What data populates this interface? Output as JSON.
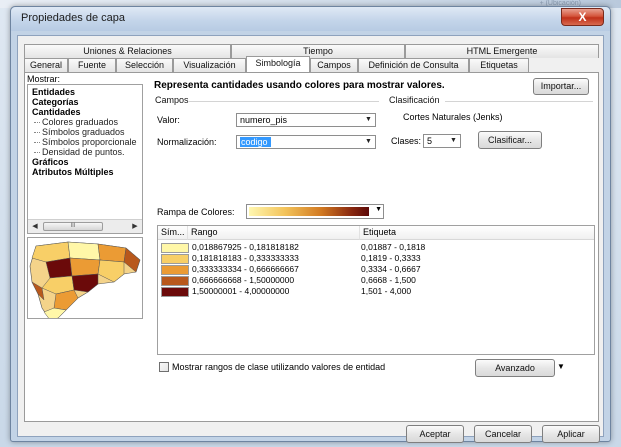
{
  "window": {
    "title": "Propiedades de capa",
    "close_label": "X"
  },
  "background": {
    "ghost_text": "+ (Ubicación)"
  },
  "tabs_row1": [
    {
      "label": "Uniones & Relaciones"
    },
    {
      "label": "Tiempo"
    },
    {
      "label": "HTML Emergente"
    }
  ],
  "tabs_row2": [
    {
      "label": "General"
    },
    {
      "label": "Fuente"
    },
    {
      "label": "Selección"
    },
    {
      "label": "Visualización"
    },
    {
      "label": "Simbología"
    },
    {
      "label": "Campos"
    },
    {
      "label": "Definición de Consulta"
    },
    {
      "label": "Etiquetas"
    }
  ],
  "active_tab": "Simbología",
  "sidebar": {
    "mostrar_label": "Mostrar:",
    "items": [
      {
        "label": "Entidades",
        "bold": true
      },
      {
        "label": "Categorías",
        "bold": true
      },
      {
        "label": "Cantidades",
        "bold": true
      },
      {
        "label": "Colores graduados",
        "bold": false
      },
      {
        "label": "Símbolos graduados",
        "bold": false
      },
      {
        "label": "Símbolos proporcionale",
        "bold": false
      },
      {
        "label": "Densidad de puntos.",
        "bold": false
      },
      {
        "label": "Gráficos",
        "bold": true
      },
      {
        "label": "Atributos Múltiples",
        "bold": true
      }
    ],
    "scroll_thumb": "III"
  },
  "main": {
    "heading": "Representa cantidades usando colores para mostrar valores.",
    "import_label": "Importar...",
    "campos": {
      "group_label": "Campos",
      "valor_label": "Valor:",
      "valor_value": "numero_pis",
      "normalizacion_label": "Normalización:",
      "normalizacion_value": "codigo"
    },
    "clasificacion": {
      "group_label": "Clasificación",
      "method": "Cortes Naturales (Jenks)",
      "clases_label": "Clases:",
      "clases_value": "5",
      "classify_label": "Clasificar..."
    },
    "ramp_label": "Rampa de Colores:",
    "table": {
      "col_sym": "Sím...",
      "col_rango": "Rango",
      "col_etiqueta": "Etiqueta",
      "rows": [
        {
          "color": "#fff7a8",
          "rango": "0,018867925 - 0,181818182",
          "etiqueta": "0,01887 - 0,1818"
        },
        {
          "color": "#f8cf67",
          "rango": "0,181818183 - 0,333333333",
          "etiqueta": "0,1819 - 0,3333"
        },
        {
          "color": "#eb9b34",
          "rango": "0,333333334 - 0,666666667",
          "etiqueta": "0,3334 - 0,6667"
        },
        {
          "color": "#b8581c",
          "rango": "0,666666668 - 1,50000000",
          "etiqueta": "0,6668 - 1,500"
        },
        {
          "color": "#6b0a0a",
          "rango": "1,50000001 - 4,00000000",
          "etiqueta": "1,501 - 4,000"
        }
      ]
    },
    "checkbox_label": "Mostrar rangos de clase utilizando valores de entidad",
    "advanced_label": "Avanzado"
  },
  "footer": {
    "accept_label": "Aceptar",
    "cancel_label": "Cancelar",
    "apply_label": "Aplicar"
  },
  "colors": {
    "ramp_start": "#fff7b0",
    "ramp_end": "#5c0808",
    "selection": "#3399ff"
  }
}
